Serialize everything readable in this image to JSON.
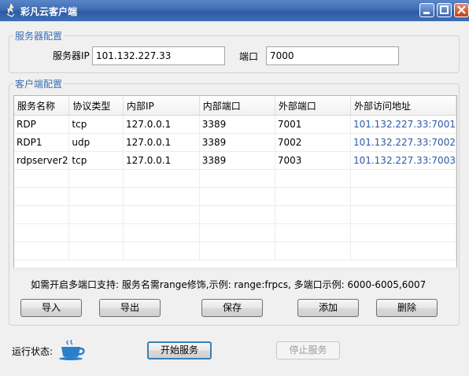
{
  "window": {
    "title": "彩凡云客户端"
  },
  "server_group": {
    "legend": "服务器配置",
    "ip_label": "服务器IP",
    "ip_value": "101.132.227.33",
    "port_label": "端口",
    "port_value": "7000"
  },
  "client_group": {
    "legend": "客户端配置",
    "columns": [
      "服务名称",
      "协议类型",
      "内部IP",
      "内部端口",
      "外部端口",
      "外部访问地址"
    ],
    "rows": [
      [
        "RDP",
        "tcp",
        "127.0.0.1",
        "3389",
        "7001",
        "101.132.227.33:7001"
      ],
      [
        "RDP1",
        "udp",
        "127.0.0.1",
        "3389",
        "7002",
        "101.132.227.33:7002"
      ],
      [
        "rdpserver2",
        "tcp",
        "127.0.0.1",
        "3389",
        "7003",
        "101.132.227.33:7003"
      ]
    ],
    "note": "如需开启多端口支持: 服务名需range修饰,示例: range:frpcs, 多端口示例: 6000-6005,6007",
    "buttons": {
      "import": "导入",
      "export": "导出",
      "save": "保存",
      "add": "添加",
      "delete": "删除"
    }
  },
  "footer": {
    "status_label": "运行状态:",
    "status_icon": "coffee-cup-icon",
    "start_label": "开始服务",
    "stop_label": "停止服务"
  },
  "colors": {
    "titlebar": "#3e6cb4",
    "legend": "#3c6eb4",
    "link": "#2a5aa8",
    "status_icon": "#2a7fc8"
  }
}
